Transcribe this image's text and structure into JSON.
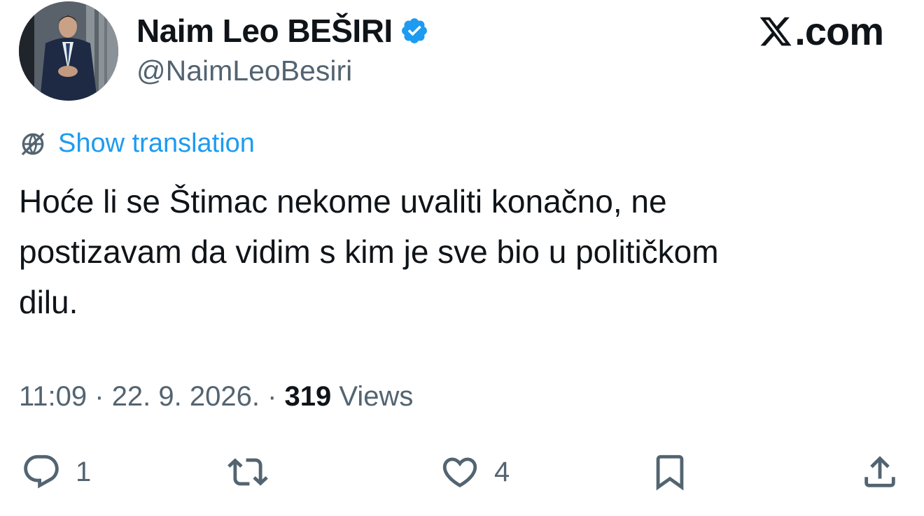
{
  "author": {
    "name": "Naim Leo BEŠIRI",
    "handle": "@NaimLeoBesiri",
    "verified": true,
    "verified_color": "#1d9bf0"
  },
  "brand": {
    "text": ".com",
    "logo_icon": "x-logo-icon"
  },
  "translation": {
    "label": "Show translation",
    "icon": "globe-icon",
    "color": "#1d9bf0"
  },
  "tweet": {
    "lines": [
      "Hoće li se Štimac nekome uvaliti konačno, ne",
      "postizavam da vidim s kim je sve bio u političkom",
      "dilu."
    ]
  },
  "meta": {
    "time": "11:09",
    "separator": " · ",
    "date": "22. 9. 2026.",
    "views_count": "319",
    "views_label": " Views"
  },
  "actions": {
    "reply": {
      "icon": "reply-icon",
      "count": "1"
    },
    "retweet": {
      "icon": "retweet-icon",
      "count": ""
    },
    "like": {
      "icon": "heart-icon",
      "count": "4"
    },
    "bookmark": {
      "icon": "bookmark-icon",
      "count": ""
    },
    "share": {
      "icon": "share-icon",
      "count": ""
    }
  }
}
